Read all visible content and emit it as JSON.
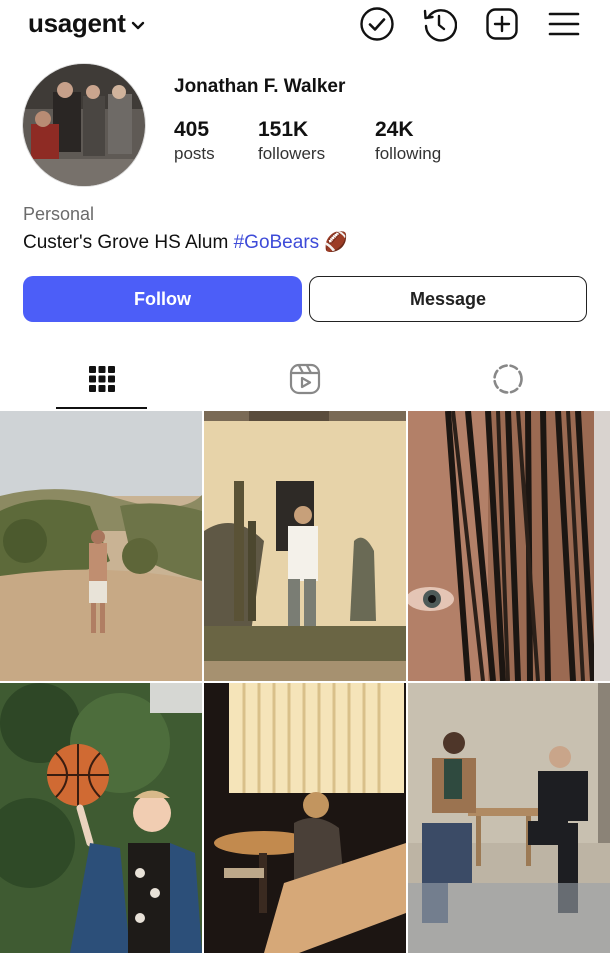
{
  "header": {
    "username": "usagent",
    "icons": [
      "check-circle-icon",
      "history-icon",
      "plus-square-icon",
      "menu-icon"
    ]
  },
  "profile": {
    "display_name": "Jonathan F. Walker",
    "stats": [
      {
        "value": "405",
        "label": "posts"
      },
      {
        "value": "151K",
        "label": "followers"
      },
      {
        "value": "24K",
        "label": "following"
      }
    ],
    "category": "Personal",
    "bio_text": "Custer's Grove HS Alum",
    "bio_hashtag": "#GoBears",
    "bio_emoji": "🏈"
  },
  "actions": {
    "follow_label": "Follow",
    "message_label": "Message"
  },
  "tabs": [
    "grid-icon",
    "reels-icon",
    "tagged-icon"
  ],
  "colors": {
    "accent": "#4c5ef8",
    "hashtag": "#3e4bd8"
  },
  "posts": [
    {
      "subject": "shirtless man walking on a dirt hill"
    },
    {
      "subject": "man standing in front of a sunlit wall"
    },
    {
      "subject": "close-up of an eye behind dark hair"
    },
    {
      "subject": "young man spinning a basketball on a finger"
    },
    {
      "subject": "woman sitting at a table near a window"
    },
    {
      "subject": "two men sitting on chairs in a courtyard"
    }
  ]
}
